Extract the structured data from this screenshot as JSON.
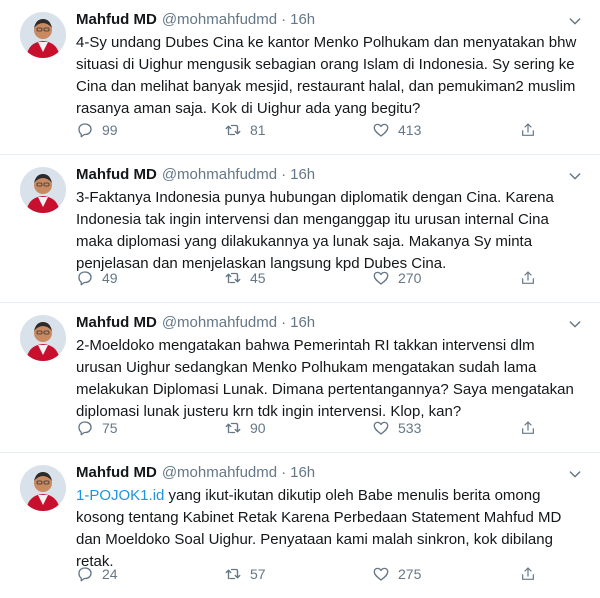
{
  "tweets": [
    {
      "name": "Mahfud MD",
      "handle": "@mohmahfudmd",
      "separator": "·",
      "time": "16h",
      "link_text": "",
      "text": "4-Sy undang Dubes Cina ke kantor Menko Polhukam dan menyatakan bhw situasi di Uighur mengusik sebagian orang Islam di Indonesia. Sy sering ke Cina dan melihat banyak mesjid, restaurant halal, dan pemukiman2 muslim rasanya aman saja. Kok di Uighur ada yang begitu?",
      "replies": "99",
      "retweets": "81",
      "likes": "413"
    },
    {
      "name": "Mahfud MD",
      "handle": "@mohmahfudmd",
      "separator": "·",
      "time": "16h",
      "link_text": "",
      "text": "3-Faktanya Indonesia punya hubungan diplomatik dengan Cina. Karena Indonesia tak ingin intervensi dan menganggap itu urusan internal Cina maka diplomasi yang dilakukannya ya lunak saja. Makanya Sy minta penjelasan dan menjelaskan langsung kpd Dubes Cina.",
      "replies": "49",
      "retweets": "45",
      "likes": "270"
    },
    {
      "name": "Mahfud MD",
      "handle": "@mohmahfudmd",
      "separator": "·",
      "time": "16h",
      "link_text": "",
      "text": "2-Moeldoko mengatakan bahwa Pemerintah RI takkan intervensi dlm urusan Uighur sedangkan Menko Polhukam mengatakan sudah lama melakukan Diplomasi Lunak. Dimana pertentangannya? Saya mengatakan diplomasi lunak justeru krn tdk ingin intervensi. Klop, kan?",
      "replies": "75",
      "retweets": "90",
      "likes": "533"
    },
    {
      "name": "Mahfud MD",
      "handle": "@mohmahfudmd",
      "separator": "·",
      "time": "16h",
      "link_text": "1-POJOK1.id",
      "text": " yang ikut-ikutan dikutip oleh Babe menulis berita omong kosong tentang Kabinet Retak Karena Perbedaan Statement Mahfud MD dan Moeldoko Soal Uighur. Penyataan kami malah sinkron, kok dibilang retak.",
      "replies": "24",
      "retweets": "57",
      "likes": "275"
    }
  ],
  "colors": {
    "text": "#14171a",
    "secondary": "#657786",
    "link": "#1b95e0",
    "divider": "#e6ecf0"
  },
  "icons": {
    "reply": "reply-icon",
    "retweet": "retweet-icon",
    "like": "like-icon",
    "share": "share-icon",
    "caret": "chevron-down-icon"
  }
}
